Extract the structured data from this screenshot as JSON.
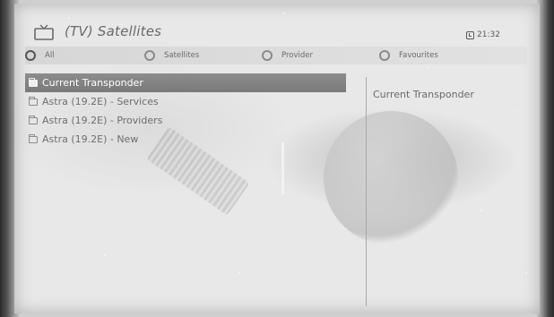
{
  "header": {
    "title": "(TV) Satellites",
    "time": "21:32"
  },
  "filters": [
    {
      "label": "All",
      "selected": true
    },
    {
      "label": "Satellites",
      "selected": false
    },
    {
      "label": "Provider",
      "selected": false
    },
    {
      "label": "Favourites",
      "selected": false
    }
  ],
  "list": {
    "items": [
      {
        "label": "Current Transponder",
        "selected": true
      },
      {
        "label": "Astra (19.2E) - Services",
        "selected": false
      },
      {
        "label": "Astra (19.2E) - Providers",
        "selected": false
      },
      {
        "label": "Astra (19.2E) - New",
        "selected": false
      }
    ]
  },
  "detail": {
    "title": "Current Transponder"
  }
}
